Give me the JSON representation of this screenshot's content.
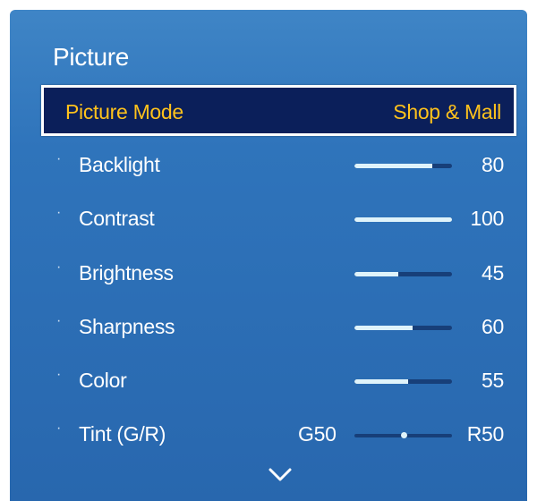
{
  "panel": {
    "title": "Picture"
  },
  "selected": {
    "label": "Picture Mode",
    "value": "Shop & Mall"
  },
  "settings": [
    {
      "bullet": "·",
      "label": "Backlight",
      "value": "80",
      "level": 0.8
    },
    {
      "bullet": "·",
      "label": "Contrast",
      "value": "100",
      "level": 1.0
    },
    {
      "bullet": "·",
      "label": "Brightness",
      "value": "45",
      "level": 0.45
    },
    {
      "bullet": "·",
      "label": "Sharpness",
      "value": "60",
      "level": 0.6
    },
    {
      "bullet": "·",
      "label": "Color",
      "value": "55",
      "level": 0.55
    }
  ],
  "tint": {
    "bullet": "·",
    "label": "Tint (G/R)",
    "left": "G50",
    "right": "R50",
    "level": 0.5
  },
  "scroll": {
    "icon": "chevron-down-icon"
  },
  "colors": {
    "panel_blue": "#2f74bb",
    "highlight_bg": "#0b1f5a",
    "highlight_text": "#ffc21c",
    "slider_fill": "#dff3fa",
    "slider_track": "#173f79"
  }
}
